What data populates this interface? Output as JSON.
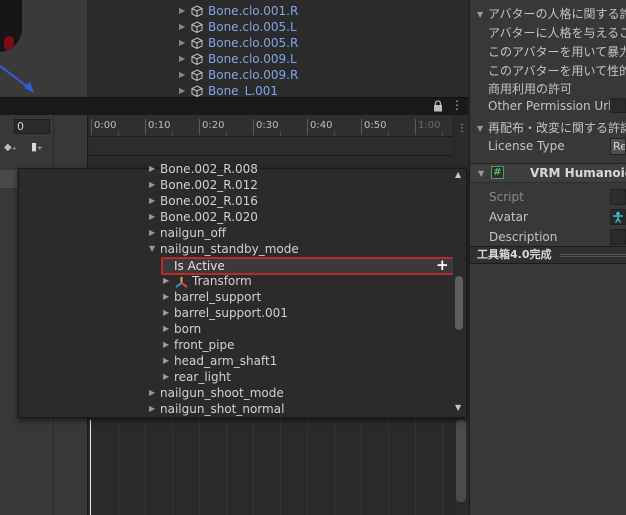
{
  "hierarchy": {
    "items": [
      {
        "label": "Bone.clo.001.R"
      },
      {
        "label": "Bone.clo.005.L"
      },
      {
        "label": "Bone.clo.005.R"
      },
      {
        "label": "Bone.clo.009.L"
      },
      {
        "label": "Bone.clo.009.R"
      },
      {
        "label": "Bone_L.001"
      }
    ]
  },
  "animation": {
    "frame_value": "0",
    "ruler_ticks": [
      "0:00",
      "0:10",
      "0:20",
      "0:30",
      "0:40",
      "0:50",
      "1:00"
    ],
    "dropdown": {
      "rows": [
        {
          "label": "Bone.002_R.008"
        },
        {
          "label": "Bone.002_R.012"
        },
        {
          "label": "Bone.002_R.016"
        },
        {
          "label": "Bone.002_R.020"
        },
        {
          "label": "nailgun_off"
        },
        {
          "label": "nailgun_standby_mode"
        },
        {
          "label": "Is Active"
        },
        {
          "label": "Transform"
        },
        {
          "label": "barrel_support"
        },
        {
          "label": "barrel_support.001"
        },
        {
          "label": "born"
        },
        {
          "label": "front_pipe"
        },
        {
          "label": "head_arm_shaft1"
        },
        {
          "label": "rear_light"
        },
        {
          "label": "nailgun_shoot_mode"
        },
        {
          "label": "nailgun_shot_normal"
        }
      ]
    }
  },
  "inspector": {
    "personality_header": "アバターの人格に関する許諾範",
    "personality_line1": "アバターに人格を与えることの",
    "personality_line2": "このアバターを用いて暴力表現",
    "personality_line3": "このアバターを用いて性的表現",
    "commercial": "商用利用の許可",
    "other_permission_url": "Other Permission Url",
    "redistribution_header": "再配布・改変に関する許諾範",
    "license_type": "License Type",
    "license_value": "Re",
    "component_title": "VRM Humanoid D",
    "script_label": "Script",
    "avatar_label": "Avatar",
    "description_label": "Description",
    "asset_label": "工具箱4.0完成"
  },
  "colors": {
    "highlight_border": "#c0262e",
    "link_blue": "#7fa6e6",
    "script_green": "#4fc16a"
  }
}
